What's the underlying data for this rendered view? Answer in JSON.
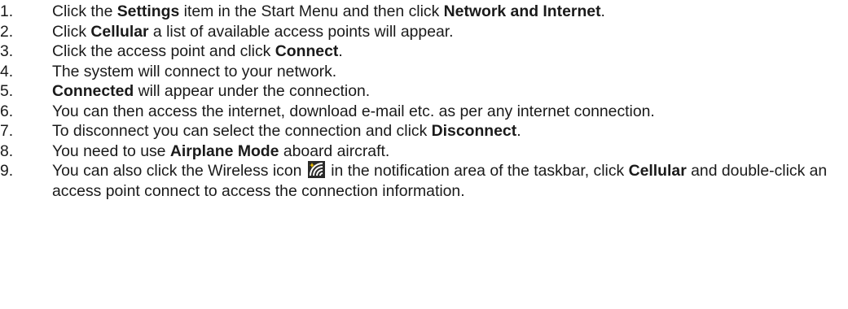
{
  "steps": [
    {
      "num": "1.",
      "parts": [
        "Click the ",
        "Settings",
        " item in the Start Menu and then click ",
        "Network and Internet",
        "."
      ]
    },
    {
      "num": "2.",
      "parts": [
        "Click ",
        "Cellular",
        " a list of available access points will appear."
      ]
    },
    {
      "num": "3.",
      "parts": [
        "Click the access point and click ",
        "Connect",
        "."
      ]
    },
    {
      "num": "4.",
      "parts": [
        "The system will connect to your network."
      ]
    },
    {
      "num": "5.",
      "parts": [
        "Connected",
        " will appear under the connection."
      ]
    },
    {
      "num": "6.",
      "parts": [
        "You can then access the internet, download e-mail etc. as per any internet connection."
      ]
    },
    {
      "num": "7.",
      "parts": [
        "To disconnect you can select the connection and click ",
        "Disconnect",
        "."
      ]
    },
    {
      "num": "8.",
      "parts": [
        "You need to use ",
        "Airplane Mode",
        " aboard aircraft."
      ]
    },
    {
      "num": "9.",
      "parts": [
        "You can also click the Wireless icon ",
        " in the notification area of the taskbar, click ",
        "Cellular",
        " and double-click an access point connect to access the connection information."
      ]
    }
  ],
  "icons": {
    "wireless": "wireless-icon",
    "wireless_colors": {
      "background": "#2b2b2b",
      "signal": "#ffffff",
      "star": "#f2c200"
    }
  }
}
